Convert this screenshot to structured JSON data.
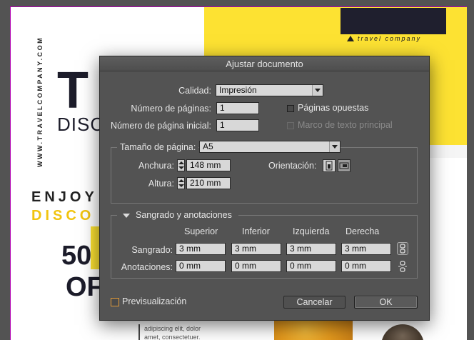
{
  "background_doc": {
    "brand_tagline": "travel company",
    "vertical_url": "WWW.TRAVELCOMPANY.COM",
    "headline_letter": "T",
    "disc_text": "DISC",
    "enjoy_text": "ENJOY",
    "disco_text": "DISCO",
    "number_text": "50",
    "off_text": "OF",
    "lorem_line1": "adipiscing elit, dolor",
    "lorem_line2": "amet, consectetuer."
  },
  "dialog": {
    "title": "Ajustar documento",
    "quality_label": "Calidad:",
    "quality_value": "Impresión",
    "num_pages_label": "Número de páginas:",
    "num_pages_value": "1",
    "start_page_label": "Número de página inicial:",
    "start_page_value": "1",
    "facing_pages_label": "Páginas opuestas",
    "primary_text_frame_label": "Marco de texto principal",
    "page_size_group_label": "Tamaño de página:",
    "page_size_value": "A5",
    "width_label": "Anchura:",
    "width_value": "148 mm",
    "height_label": "Altura:",
    "height_value": "210 mm",
    "orientation_label": "Orientación:",
    "bleed_group_label": "Sangrado y anotaciones",
    "col_top": "Superior",
    "col_bottom": "Inferior",
    "col_left": "Izquierda",
    "col_right": "Derecha",
    "bleed_label": "Sangrado:",
    "bleed_values": [
      "3 mm",
      "3 mm",
      "3 mm",
      "3 mm"
    ],
    "slug_label": "Anotaciones:",
    "slug_values": [
      "0 mm",
      "0 mm",
      "0 mm",
      "0 mm"
    ],
    "preview_label": "Previsualización",
    "cancel_label": "Cancelar",
    "ok_label": "OK"
  },
  "colors": {
    "dialog_bg": "#535353",
    "accent_yellow": "#fde232",
    "preview_checkbox": "#e09a3a"
  }
}
